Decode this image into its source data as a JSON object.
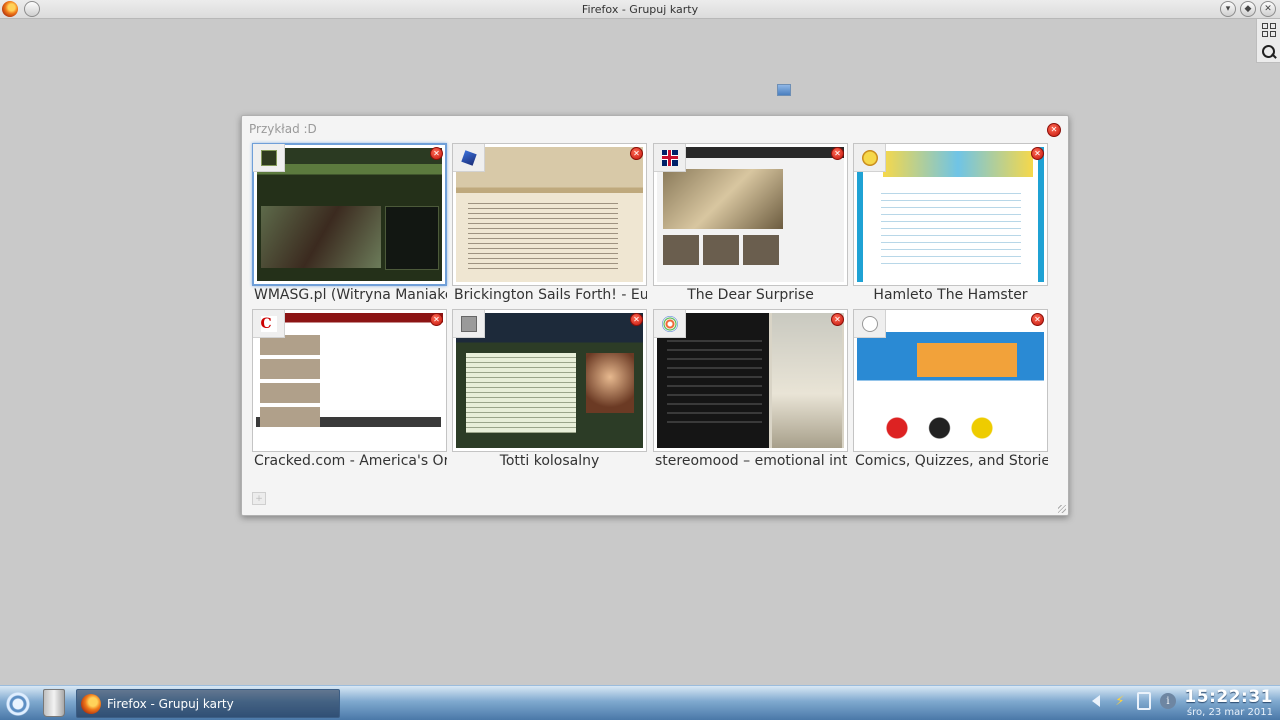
{
  "window": {
    "title": "Firefox - Grupuj karty"
  },
  "group": {
    "title": "Przykład :D",
    "tabs": [
      {
        "label": "WMASG.pl (Witryna Maniaków",
        "icon": "wmasg-favicon-icon",
        "align": "left",
        "active": true
      },
      {
        "label": "Brickington Sails Forth! - Eur",
        "icon": "ship-favicon-icon",
        "align": "left",
        "active": false
      },
      {
        "label": "The Dear Surprise",
        "icon": "uk-flag-favicon-icon",
        "align": "center",
        "active": false
      },
      {
        "label": "Hamleto The Hamster",
        "icon": "hamster-favicon-icon",
        "align": "center",
        "active": false
      },
      {
        "label": "Cracked.com - America's Or",
        "icon": "cracked-favicon-icon",
        "align": "left",
        "active": false
      },
      {
        "label": "Totti kolosalny",
        "icon": "totti-favicon-icon",
        "align": "center",
        "active": false
      },
      {
        "label": "stereomood – emotional int",
        "icon": "stereomood-favicon-icon",
        "align": "left",
        "active": false
      },
      {
        "label": "Comics, Quizzes, and Stories",
        "icon": "oatmeal-favicon-icon",
        "align": "left",
        "active": false
      }
    ]
  },
  "taskbar": {
    "task_label": "Firefox - Grupuj karty",
    "time": "15:22:31",
    "date": "śro, 23 mar 2011"
  },
  "colors": {
    "accent": "#6f9fd8",
    "close": "#d9261c",
    "taskbar": "#4a78a8"
  }
}
